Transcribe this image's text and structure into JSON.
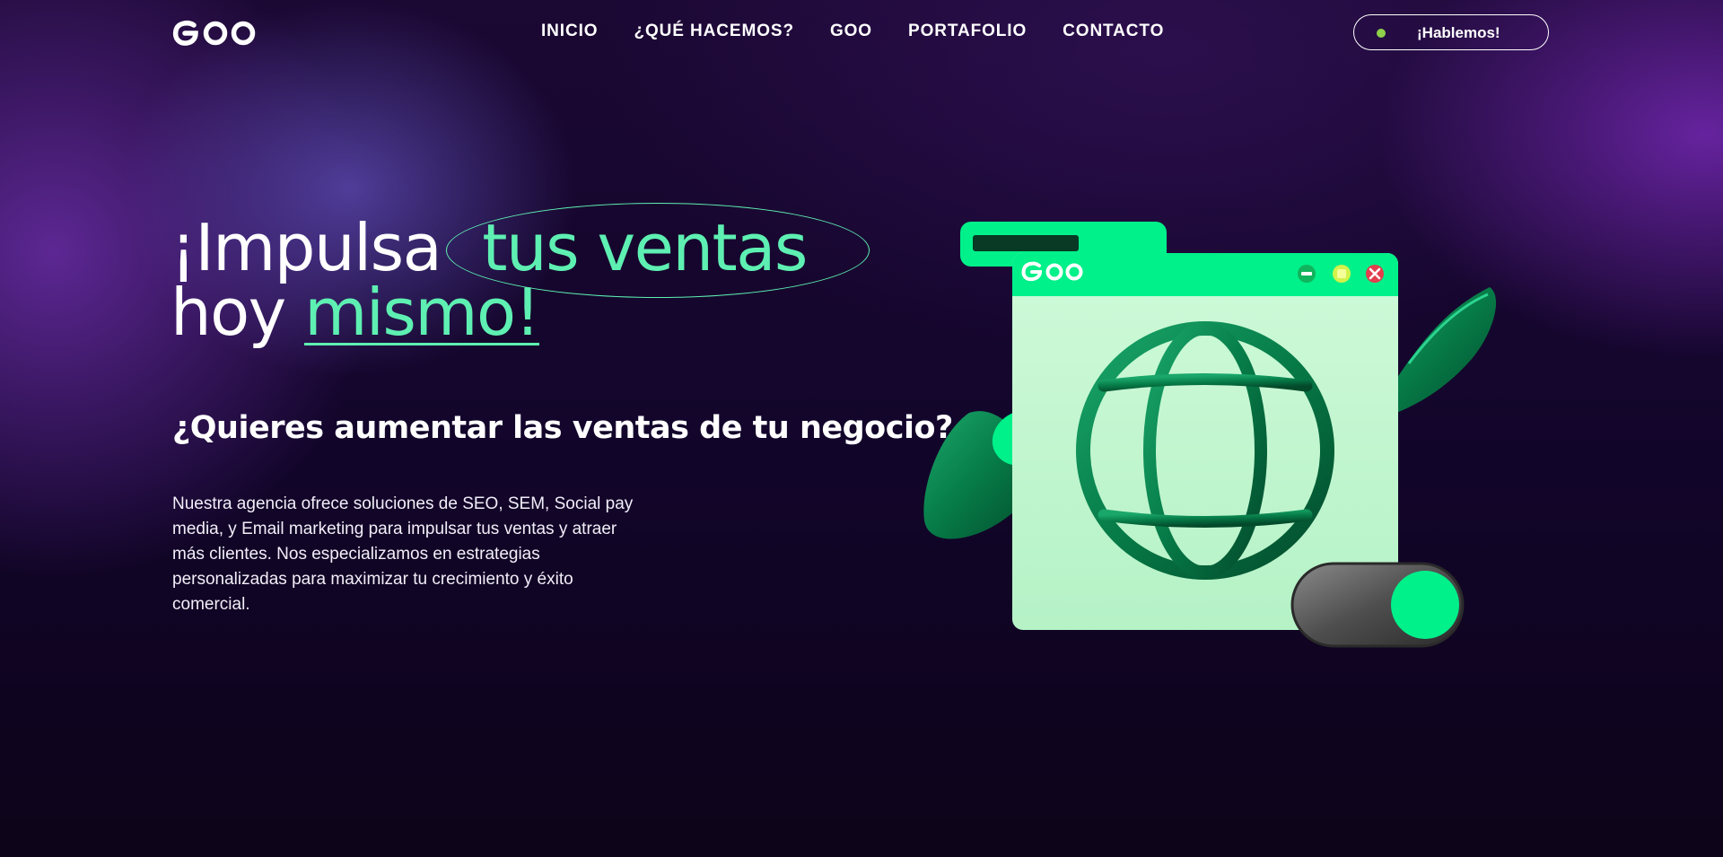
{
  "brand": {
    "logo_text": "Goo"
  },
  "nav": {
    "items": [
      {
        "label": "INICIO"
      },
      {
        "label": "¿QUÉ HACEMOS?"
      },
      {
        "label": "GOO"
      },
      {
        "label": "PORTAFOLIO"
      },
      {
        "label": "CONTACTO"
      }
    ],
    "cta_label": "¡Hablemos!"
  },
  "hero": {
    "title_part1": "¡Impulsa",
    "title_highlight": "tus ventas",
    "title_part2": "hoy",
    "title_underlined": "mismo!",
    "subtitle": "¿Quieres aumentar las ventas de tu negocio?",
    "description": "Nuestra agencia ofrece soluciones de SEO, SEM, Social pay media, y Email marketing para impulsar tus ventas y atraer más clientes. Nos especializamos en estrategias personalizadas para maximizar tu crecimiento y éxito comercial."
  },
  "illustration": {
    "window_logo_text": "Goo"
  },
  "colors": {
    "accent_green": "#5ef0b2",
    "neon_green": "#00f08a",
    "background": "#0d0419",
    "purple": "#6b2aa8",
    "cta_dot": "#8fd14b"
  }
}
